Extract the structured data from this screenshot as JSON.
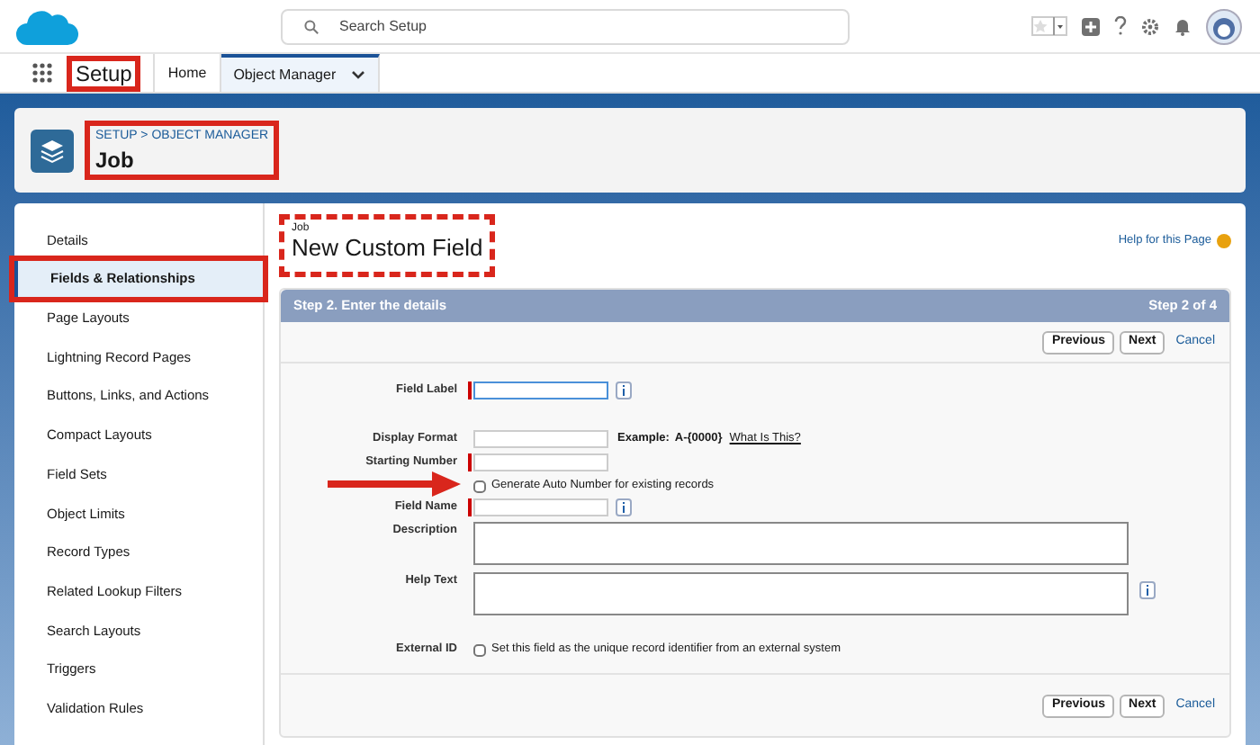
{
  "header": {
    "search": {
      "placeholder": "Search Setup"
    }
  },
  "nav": {
    "app_name": "Setup",
    "app_highlighted": true,
    "tabs": [
      {
        "label": "Home",
        "selected": false,
        "dropdown": false
      },
      {
        "label": "Object Manager",
        "selected": true,
        "dropdown": true
      }
    ]
  },
  "object_header": {
    "breadcrumb": [
      "SETUP",
      "OBJECT MANAGER"
    ],
    "separator": ">",
    "title": "Job",
    "highlighted": true
  },
  "sidebar": {
    "items": [
      {
        "label": "Details",
        "selected": false,
        "highlighted": false
      },
      {
        "label": "Fields & Relationships",
        "selected": true,
        "highlighted": true
      },
      {
        "label": "Page Layouts",
        "selected": false,
        "highlighted": false
      },
      {
        "label": "Lightning Record Pages",
        "selected": false,
        "highlighted": false
      },
      {
        "label": "Buttons, Links, and Actions",
        "selected": false,
        "highlighted": false
      },
      {
        "label": "Compact Layouts",
        "selected": false,
        "highlighted": false
      },
      {
        "label": "Field Sets",
        "selected": false,
        "highlighted": false
      },
      {
        "label": "Object Limits",
        "selected": false,
        "highlighted": false
      },
      {
        "label": "Record Types",
        "selected": false,
        "highlighted": false
      },
      {
        "label": "Related Lookup Filters",
        "selected": false,
        "highlighted": false
      },
      {
        "label": "Search Layouts",
        "selected": false,
        "highlighted": false
      },
      {
        "label": "Triggers",
        "selected": false,
        "highlighted": false
      },
      {
        "label": "Validation Rules",
        "selected": false,
        "highlighted": false
      }
    ]
  },
  "page": {
    "object": "Job",
    "title": "New Custom Field",
    "highlighted": true,
    "help_link": "Help for this Page"
  },
  "form": {
    "step_title": "Step 2. Enter the details",
    "step_count": "Step 2 of 4",
    "buttons_top": [
      "Previous",
      "Next"
    ],
    "cancel_top": "Cancel",
    "rows": [
      {
        "kind": "text",
        "label": "Field Label",
        "required": true,
        "info": true,
        "focused": true
      },
      {
        "kind": "format",
        "label": "Display Format",
        "example_label": "Example:",
        "example": "A-{0000}",
        "link": "What Is This?"
      },
      {
        "kind": "text",
        "label": "Starting Number",
        "required": true,
        "info": false,
        "focused": false
      },
      {
        "kind": "checkbox",
        "text": "Generate Auto Number for existing records",
        "checked": false,
        "arrow": true
      },
      {
        "kind": "text",
        "label": "Field Name",
        "required": true,
        "info": true,
        "focused": false
      },
      {
        "kind": "textarea",
        "label": "Description",
        "info": false
      },
      {
        "kind": "textarea",
        "label": "Help Text",
        "info": true
      },
      {
        "kind": "checkbox",
        "label": "External ID",
        "text": "Set this field as the unique record identifier from an external system",
        "checked": false,
        "arrow": false
      }
    ],
    "buttons_bottom": [
      "Previous",
      "Next"
    ],
    "cancel_bottom": "Cancel"
  }
}
